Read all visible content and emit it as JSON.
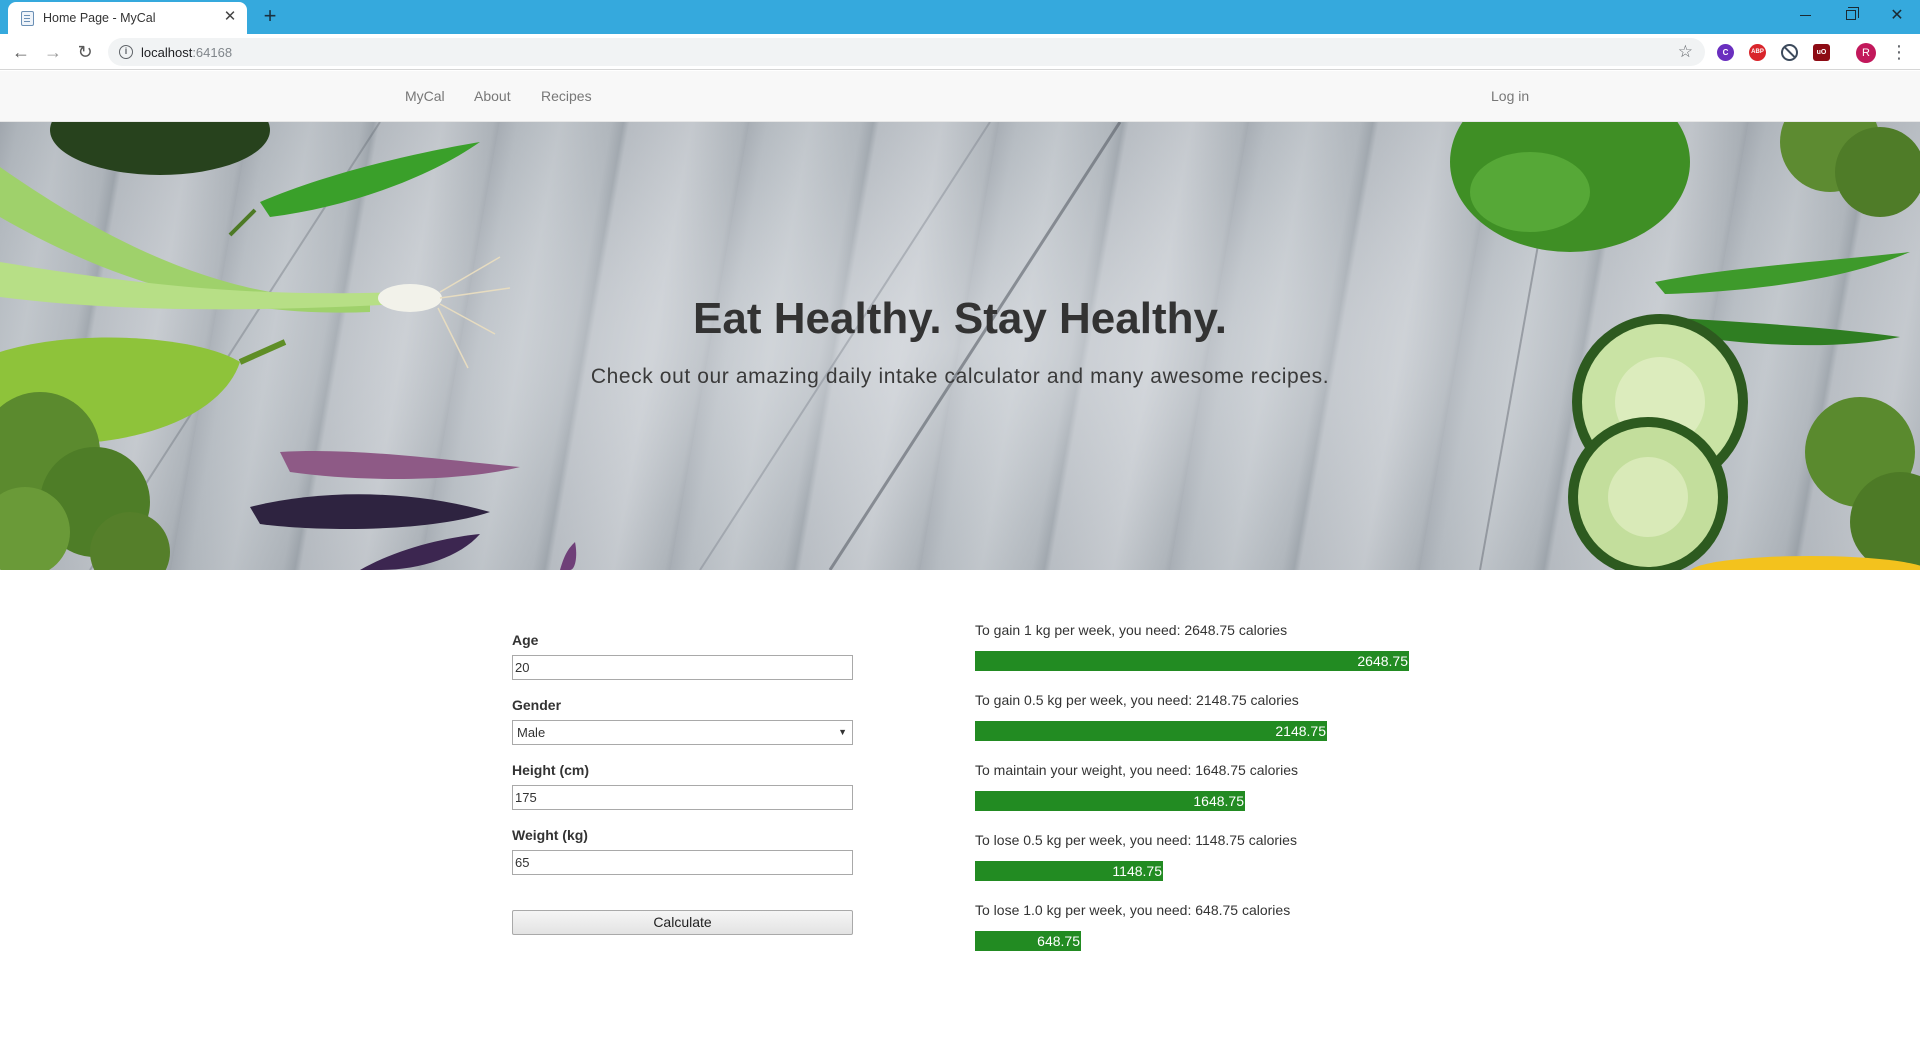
{
  "browser": {
    "tab_title": "Home Page - MyCal",
    "tab_close_glyph": "✕",
    "new_tab_glyph": "+",
    "url_host": "localhost",
    "url_port": ":64168",
    "avatar_letter": "R",
    "ext_c_label": "C",
    "ext_abp_label": "ABP",
    "ext_ub_label": "uO"
  },
  "navbar": {
    "brand": "MyCal",
    "about": "About",
    "recipes": "Recipes",
    "login": "Log in"
  },
  "hero": {
    "title": "Eat Healthy. Stay Healthy.",
    "subtitle": "Check out our amazing daily intake calculator and many awesome recipes."
  },
  "form": {
    "age_label": "Age",
    "age_value": "20",
    "gender_label": "Gender",
    "gender_value": "Male",
    "height_label": "Height (cm)",
    "height_value": "175",
    "weight_label": "Weight (kg)",
    "weight_value": "65",
    "calculate_label": "Calculate"
  },
  "results": [
    {
      "text": "To gain 1 kg per week, you need: 2648.75 calories",
      "value": 2648.75,
      "bar_label": "2648.75"
    },
    {
      "text": "To gain 0.5 kg per week, you need: 2148.75 calories",
      "value": 2148.75,
      "bar_label": "2148.75"
    },
    {
      "text": "To maintain your weight, you need: 1648.75 calories",
      "value": 1648.75,
      "bar_label": "1648.75"
    },
    {
      "text": "To lose 0.5 kg per week, you need: 1148.75 calories",
      "value": 1148.75,
      "bar_label": "1148.75"
    },
    {
      "text": "To lose 1.0 kg per week, you need: 648.75 calories",
      "value": 648.75,
      "bar_label": "648.75"
    }
  ],
  "colors": {
    "chrome_tabbar": "#35a9dd",
    "navbar_bg": "#f8f8f8",
    "result_bar": "#228b22"
  }
}
